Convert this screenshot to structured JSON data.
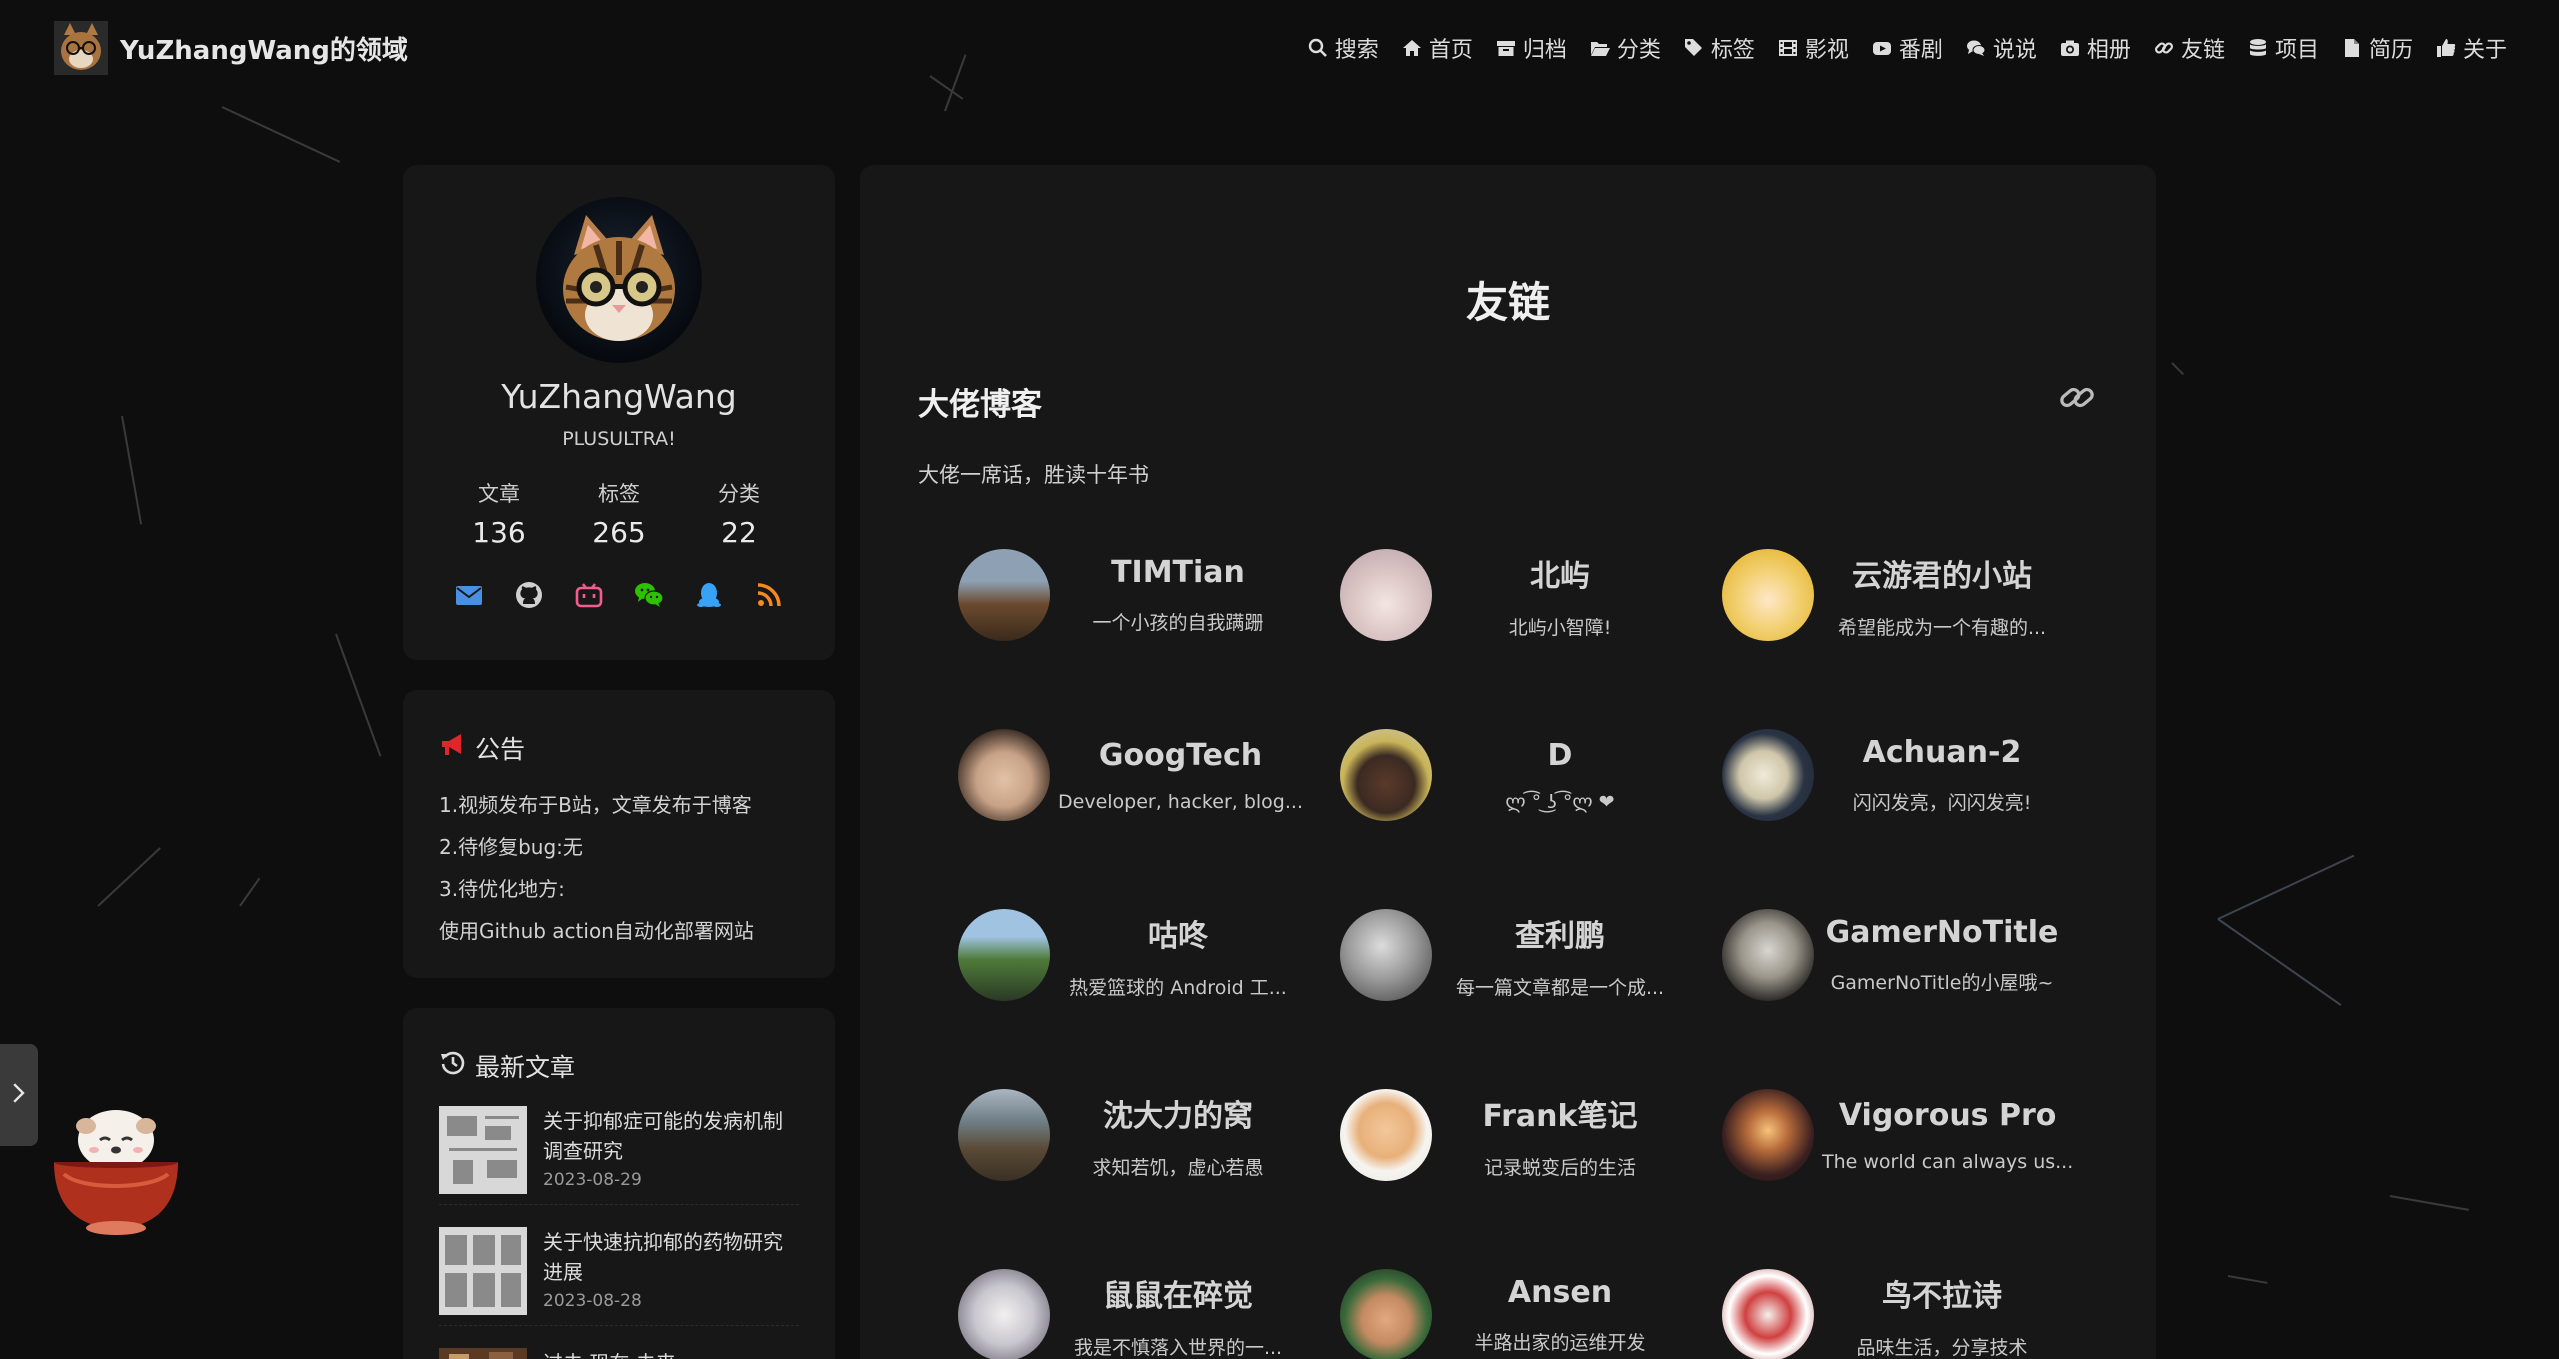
{
  "site": {
    "title": "YuZhangWang的领域"
  },
  "nav": {
    "items": [
      {
        "label": "搜索",
        "icon": "search-icon"
      },
      {
        "label": "首页",
        "icon": "home-icon"
      },
      {
        "label": "归档",
        "icon": "archive-icon"
      },
      {
        "label": "分类",
        "icon": "folder-open-icon"
      },
      {
        "label": "标签",
        "icon": "tags-icon"
      },
      {
        "label": "影视",
        "icon": "film-icon"
      },
      {
        "label": "番剧",
        "icon": "youtube-icon"
      },
      {
        "label": "说说",
        "icon": "comments-icon"
      },
      {
        "label": "相册",
        "icon": "camera-icon"
      },
      {
        "label": "友链",
        "icon": "link-icon"
      },
      {
        "label": "项目",
        "icon": "database-icon"
      },
      {
        "label": "简历",
        "icon": "file-icon"
      },
      {
        "label": "关于",
        "icon": "thumbs-up-icon"
      }
    ]
  },
  "profile": {
    "name": "YuZhangWang",
    "motto": "PLUSULTRA!",
    "stats": [
      {
        "label": "文章",
        "value": "136"
      },
      {
        "label": "标签",
        "value": "265"
      },
      {
        "label": "分类",
        "value": "22"
      }
    ],
    "socials": [
      {
        "icon": "email-icon",
        "color": "#4a90e2"
      },
      {
        "icon": "github-icon",
        "color": "#d0d0d0"
      },
      {
        "icon": "bilibili-icon",
        "color": "#f25d8e"
      },
      {
        "icon": "wechat-icon",
        "color": "#2dc100"
      },
      {
        "icon": "qq-icon",
        "color": "#38a3f5"
      },
      {
        "icon": "rss-icon",
        "color": "#f58a1f"
      }
    ]
  },
  "notice": {
    "title": "公告",
    "lines": [
      "1.视频发布于B站，文章发布于博客",
      "2.待修复bug:无",
      "3.待优化地方:",
      "使用Github action自动化部署网站"
    ]
  },
  "recent": {
    "title": "最新文章",
    "posts": [
      {
        "title_1": "关于抑郁症可能的发病机制",
        "title_2": "调查研究",
        "date": "2023-08-29"
      },
      {
        "title_1": "关于快速抗抑郁的药物研究",
        "title_2": "进展",
        "date": "2023-08-28"
      },
      {
        "title_1": "过去 现在 未来",
        "title_2": "",
        "date": ""
      }
    ]
  },
  "main": {
    "page_title": "友链",
    "section_title": "大佬博客",
    "section_desc": "大佬一席话，胜读十年书",
    "friends": [
      {
        "name": "TIMTian",
        "desc": "一个小孩的自我蹒跚"
      },
      {
        "name": "北屿",
        "desc": "北屿小智障!"
      },
      {
        "name": "云游君的小站",
        "desc": "希望能成为一个有趣的..."
      },
      {
        "name": "GoogTech",
        "desc": "Developer, hacker, blog..."
      },
      {
        "name": "D",
        "desc": "ლ ͡° ͜ʖ ͡°ლ ❤"
      },
      {
        "name": "Achuan-2",
        "desc": "闪闪发亮，闪闪发亮!"
      },
      {
        "name": "咕咚",
        "desc": "热爱篮球的 Android 工..."
      },
      {
        "name": "查利鹏",
        "desc": "每一篇文章都是一个成..."
      },
      {
        "name": "GamerNoTitle",
        "desc": "GamerNoTitle的小屋哦~"
      },
      {
        "name": "沈大力的窝",
        "desc": "求知若饥，虚心若愚"
      },
      {
        "name": "Frank笔记",
        "desc": "记录蜕变后的生活"
      },
      {
        "name": "Vigorous Pro",
        "desc": "The world can always us..."
      },
      {
        "name": "鼠鼠在碎觉",
        "desc": "我是不慎落入世界的一..."
      },
      {
        "name": "Ansen",
        "desc": "半路出家的运维开发"
      },
      {
        "name": "鸟不拉诗",
        "desc": "品味生活，分享技术"
      }
    ]
  }
}
